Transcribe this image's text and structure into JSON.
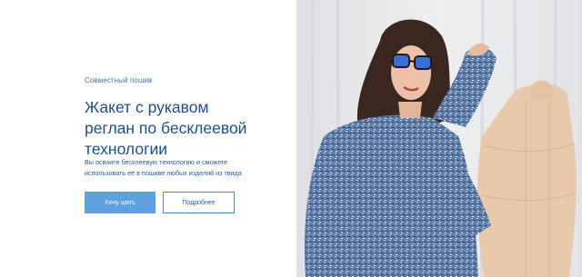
{
  "hero": {
    "eyebrow": "Совместный пошив",
    "title_lines": [
      "Жакет с рукавом",
      "реглан по бесклеевой",
      "технологии"
    ],
    "description_lines": [
      "Вы освоите бесклеевую технологию и сможете",
      "использовать её в пошиве любых изделий из твида"
    ],
    "primary_button": "Хочу шить",
    "secondary_button": "Подробнее"
  },
  "colors": {
    "accent": "#5fa0e0",
    "title": "#1f4e8c",
    "text": "#2c5c9a"
  }
}
